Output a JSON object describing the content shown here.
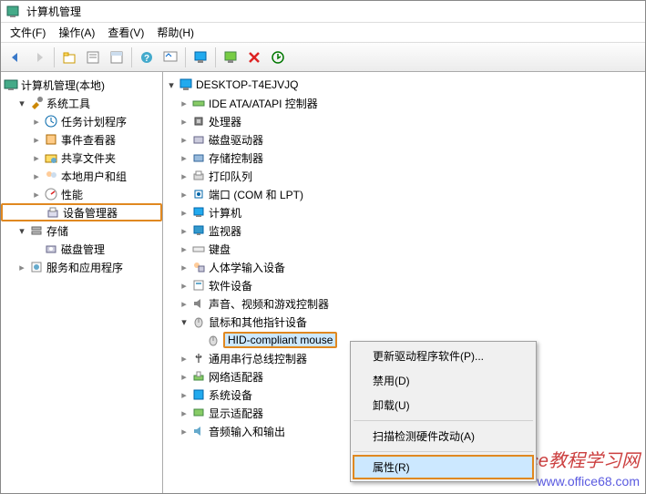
{
  "window": {
    "title": "计算机管理"
  },
  "menubar": [
    "文件(F)",
    "操作(A)",
    "查看(V)",
    "帮助(H)"
  ],
  "toolbar_icons": [
    "back",
    "forward",
    "up",
    "show-hide",
    "properties",
    "help",
    "help2",
    "monitor",
    "monitor2",
    "device",
    "delete",
    "scan"
  ],
  "left_tree": {
    "root": "计算机管理(本地)",
    "sys_tools": "系统工具",
    "sys_children": [
      "任务计划程序",
      "事件查看器",
      "共享文件夹",
      "本地用户和组",
      "性能",
      "设备管理器"
    ],
    "storage": "存储",
    "storage_children": [
      "磁盘管理"
    ],
    "services": "服务和应用程序"
  },
  "right_tree": {
    "root": "DESKTOP-T4EJVJQ",
    "categories": [
      {
        "label": "IDE ATA/ATAPI 控制器",
        "exp": false
      },
      {
        "label": "处理器",
        "exp": false
      },
      {
        "label": "磁盘驱动器",
        "exp": false
      },
      {
        "label": "存储控制器",
        "exp": false
      },
      {
        "label": "打印队列",
        "exp": false
      },
      {
        "label": "端口 (COM 和 LPT)",
        "exp": false
      },
      {
        "label": "计算机",
        "exp": false
      },
      {
        "label": "监视器",
        "exp": false
      },
      {
        "label": "键盘",
        "exp": false
      },
      {
        "label": "人体学输入设备",
        "exp": false
      },
      {
        "label": "软件设备",
        "exp": false
      },
      {
        "label": "声音、视频和游戏控制器",
        "exp": false
      },
      {
        "label": "鼠标和其他指针设备",
        "exp": true,
        "child": "HID-compliant mouse"
      },
      {
        "label": "通用串行总线控制器",
        "exp": false
      },
      {
        "label": "网络适配器",
        "exp": false
      },
      {
        "label": "系统设备",
        "exp": false
      },
      {
        "label": "显示适配器",
        "exp": false
      },
      {
        "label": "音频输入和输出",
        "exp": false
      }
    ]
  },
  "context_menu": {
    "items": [
      "更新驱动程序软件(P)...",
      "禁用(D)",
      "卸载(U)"
    ],
    "items2": [
      "扫描检测硬件改动(A)"
    ],
    "highlighted": "属性(R)"
  },
  "watermark": {
    "line1": "office教程学习网",
    "line2": "www.office68.com"
  }
}
